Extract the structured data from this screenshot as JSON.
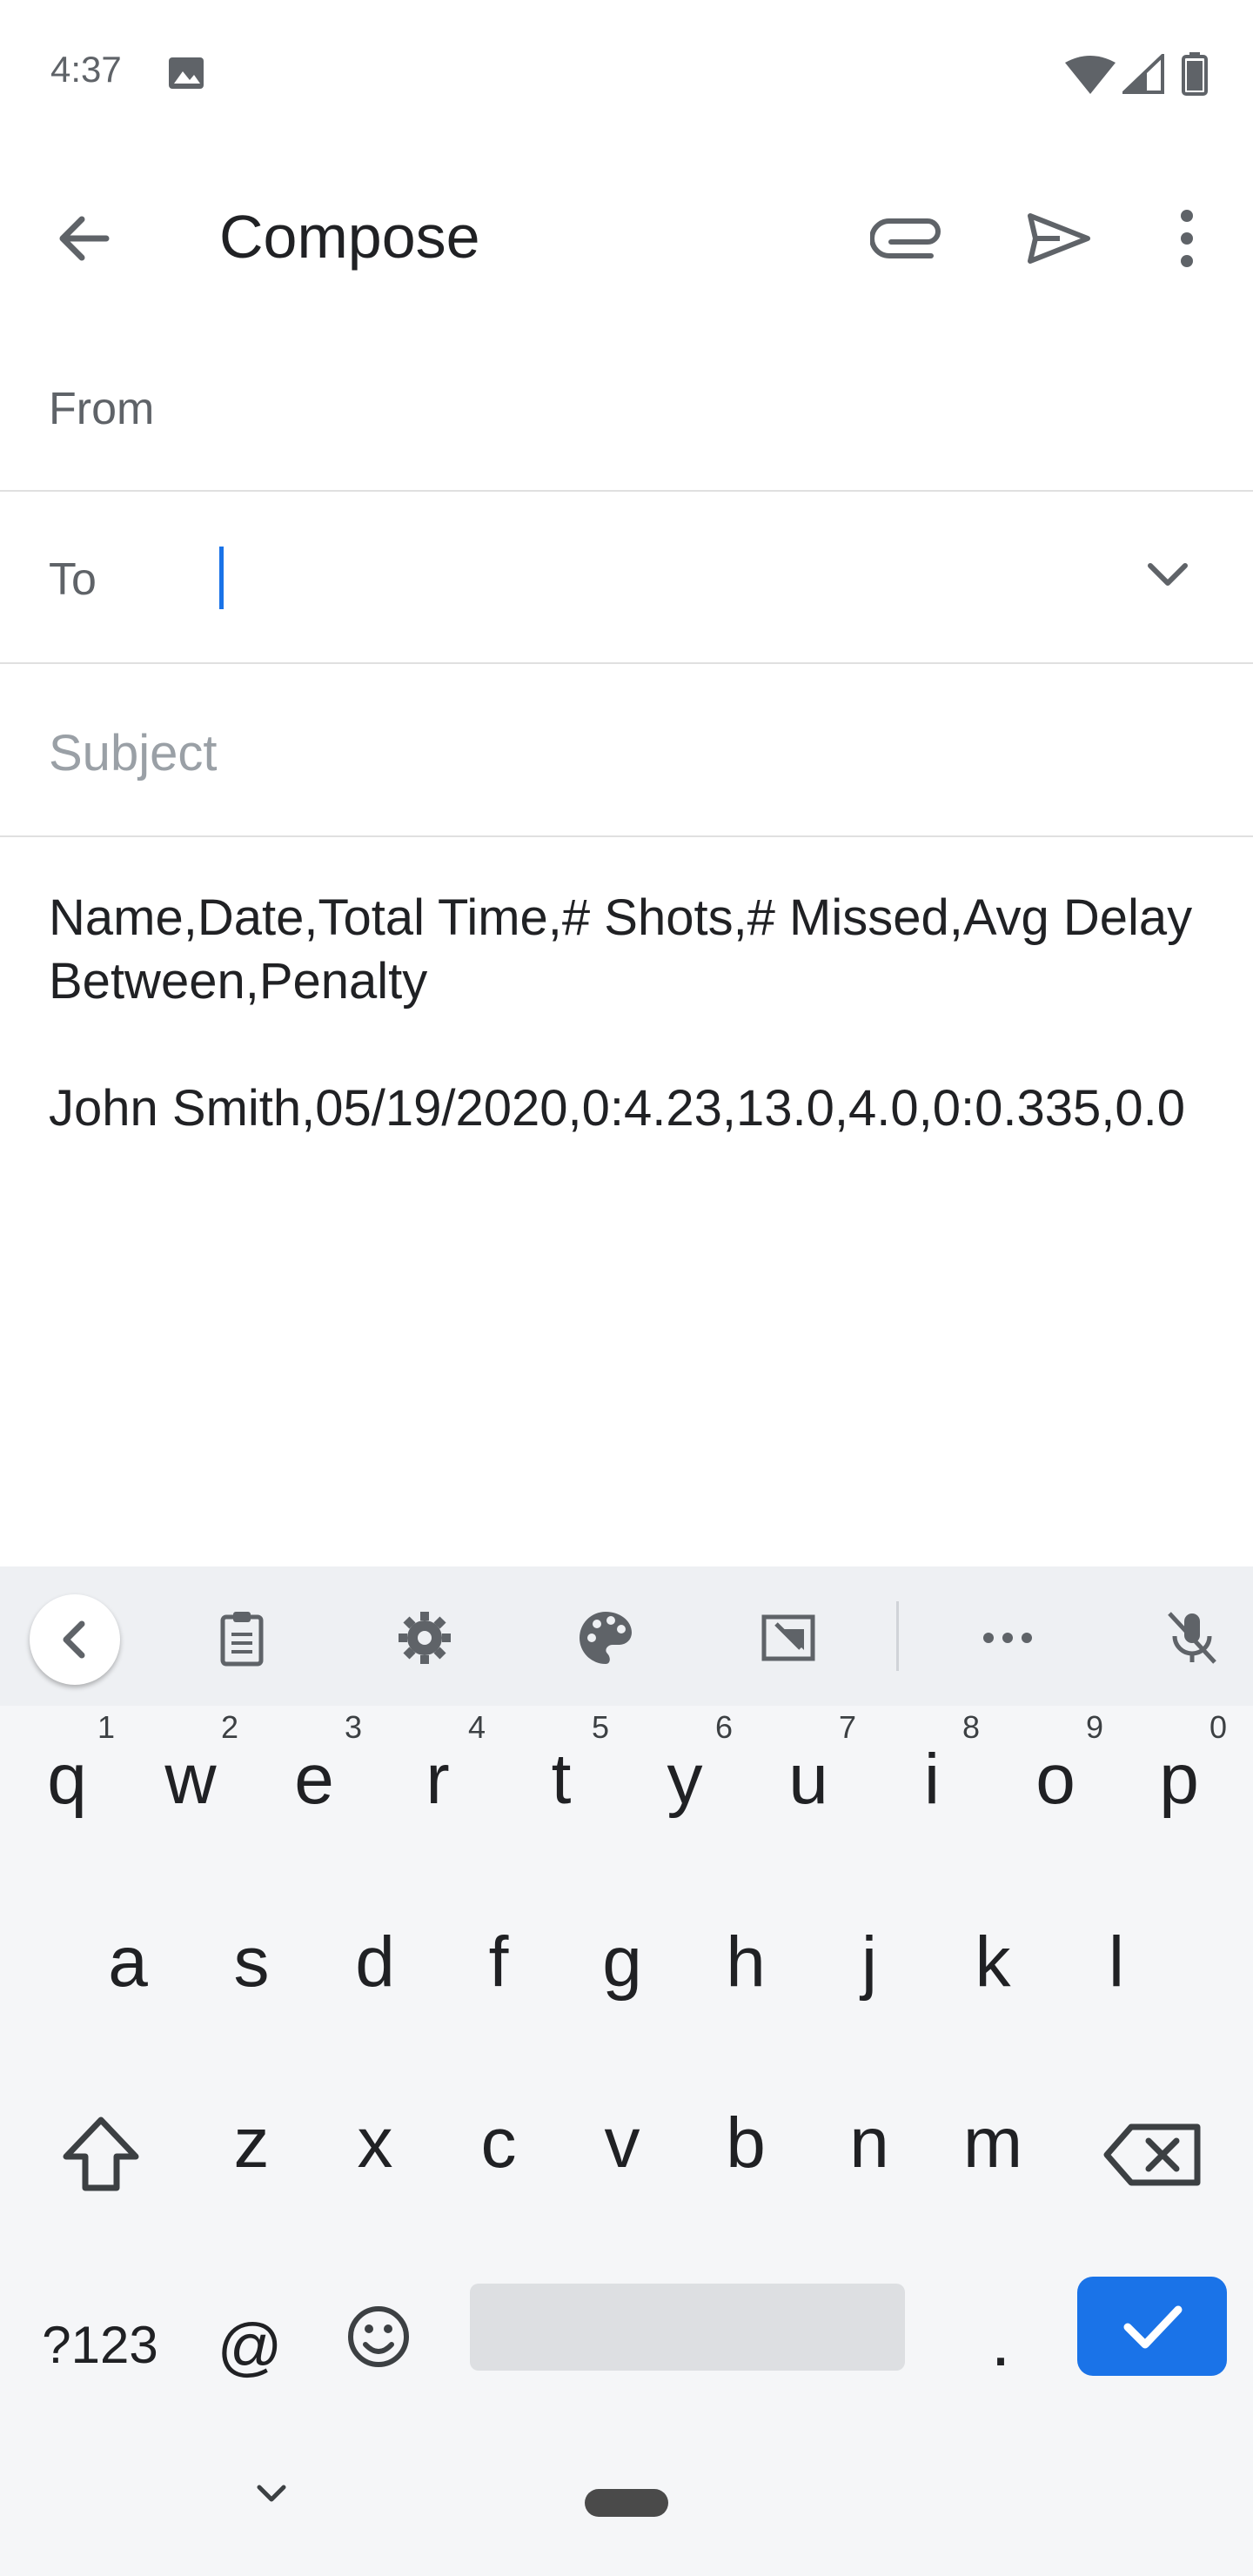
{
  "status_bar": {
    "time": "4:37"
  },
  "toolbar": {
    "title": "Compose"
  },
  "fields": {
    "from_label": "From",
    "to_label": "To",
    "to_value": "",
    "subject_placeholder": "Subject"
  },
  "body": {
    "text": "Name,Date,Total Time,# Shots,# Missed,Avg Delay Between,Penalty\n\nJohn Smith,05/19/2020,0:4.23,13.0,4.0,0:0.335,0.0"
  },
  "keyboard": {
    "row1": [
      {
        "key": "q",
        "hint": "1"
      },
      {
        "key": "w",
        "hint": "2"
      },
      {
        "key": "e",
        "hint": "3"
      },
      {
        "key": "r",
        "hint": "4"
      },
      {
        "key": "t",
        "hint": "5"
      },
      {
        "key": "y",
        "hint": "6"
      },
      {
        "key": "u",
        "hint": "7"
      },
      {
        "key": "i",
        "hint": "8"
      },
      {
        "key": "o",
        "hint": "9"
      },
      {
        "key": "p",
        "hint": "0"
      }
    ],
    "row2": [
      "a",
      "s",
      "d",
      "f",
      "g",
      "h",
      "j",
      "k",
      "l"
    ],
    "row3": [
      "z",
      "x",
      "c",
      "v",
      "b",
      "n",
      "m"
    ],
    "symbols_label": "?123",
    "at_label": "@",
    "period_label": ".",
    "accent_color": "#1a73e8"
  },
  "icons": {
    "status": [
      "gallery-icon",
      "wifi-icon",
      "signal-icon",
      "battery-icon"
    ],
    "toolbar": [
      "back-arrow-icon",
      "paperclip-icon",
      "send-icon",
      "more-vert-icon"
    ],
    "kb_tools": [
      "chevron-left-icon",
      "clipboard-icon",
      "gear-icon",
      "palette-icon",
      "resize-icon",
      "more-horiz-icon",
      "mic-off-icon"
    ]
  }
}
